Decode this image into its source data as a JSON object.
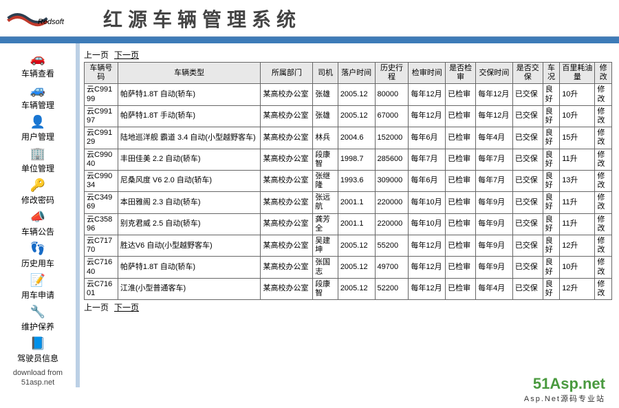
{
  "header": {
    "logo_text": "Redsoft",
    "title": "红源车辆管理系统"
  },
  "sidebar": {
    "items": [
      {
        "label": "车辆查看",
        "icon": "🚗"
      },
      {
        "label": "车辆管理",
        "icon": "🚙"
      },
      {
        "label": "用户管理",
        "icon": "👤"
      },
      {
        "label": "单位管理",
        "icon": "🏢"
      },
      {
        "label": "修改密码",
        "icon": "🔑"
      },
      {
        "label": "车辆公告",
        "icon": "📣"
      },
      {
        "label": "历史用车",
        "icon": "👣"
      },
      {
        "label": "用车申请",
        "icon": "📝"
      },
      {
        "label": "维护保养",
        "icon": "🔧"
      },
      {
        "label": "驾驶员信息",
        "icon": "📘"
      }
    ],
    "download_line1": "download from",
    "download_line2": "51asp.net"
  },
  "pager": {
    "prev": "上一页",
    "next": "下一页"
  },
  "table": {
    "headers": [
      "车辆号码",
      "车辆类型",
      "所属部门",
      "司机",
      "落户时间",
      "历史行程",
      "检审时间",
      "是否检审",
      "交保时间",
      "是否交保",
      "车况",
      "百里耗油量",
      "修改"
    ],
    "rows": [
      {
        "id": "云C99199",
        "type": "帕萨特1.8T 自动(轿车)",
        "dept": "某高校办公室",
        "driver": "张雄",
        "date": "2005.12",
        "mileage": "80000",
        "insp": "每年12月",
        "insp_ok": "已检审",
        "ins": "每年12月",
        "ins_ok": "已交保",
        "cond": "良好",
        "fuel": "10升",
        "edit": "修改"
      },
      {
        "id": "云C99197",
        "type": "帕萨特1.8T 手动(轿车)",
        "dept": "某高校办公室",
        "driver": "张雄",
        "date": "2005.12",
        "mileage": "67000",
        "insp": "每年12月",
        "insp_ok": "已检审",
        "ins": "每年12月",
        "ins_ok": "已交保",
        "cond": "良好",
        "fuel": "10升",
        "edit": "修改"
      },
      {
        "id": "云C99129",
        "type": "陆地巡洋舰 霸道 3.4 自动(小型越野客车)",
        "dept": "某高校办公室",
        "driver": "林兵",
        "date": "2004.6",
        "mileage": "152000",
        "insp": "每年6月",
        "insp_ok": "已检审",
        "ins": "每年4月",
        "ins_ok": "已交保",
        "cond": "良好",
        "fuel": "15升",
        "edit": "修改"
      },
      {
        "id": "云C99040",
        "type": "丰田佳美 2.2 自动(轿车)",
        "dept": "某高校办公室",
        "driver": "段康智",
        "date": "1998.7",
        "mileage": "285600",
        "insp": "每年7月",
        "insp_ok": "已检审",
        "ins": "每年7月",
        "ins_ok": "已交保",
        "cond": "良好",
        "fuel": "11升",
        "edit": "修改"
      },
      {
        "id": "云C99034",
        "type": "尼桑风度 V6 2.0 自动(轿车)",
        "dept": "某高校办公室",
        "driver": "张继隆",
        "date": "1993.6",
        "mileage": "309000",
        "insp": "每年6月",
        "insp_ok": "已检审",
        "ins": "每年7月",
        "ins_ok": "已交保",
        "cond": "良好",
        "fuel": "13升",
        "edit": "修改"
      },
      {
        "id": "云C34969",
        "type": "本田雅阁 2.3 自动(轿车)",
        "dept": "某高校办公室",
        "driver": "张远航",
        "date": "2001.1",
        "mileage": "220000",
        "insp": "每年10月",
        "insp_ok": "已检审",
        "ins": "每年9月",
        "ins_ok": "已交保",
        "cond": "良好",
        "fuel": "11升",
        "edit": "修改"
      },
      {
        "id": "云C35896",
        "type": "别克君威 2.5 自动(轿车)",
        "dept": "某高校办公室",
        "driver": "龚芳全",
        "date": "2001.1",
        "mileage": "220000",
        "insp": "每年10月",
        "insp_ok": "已检审",
        "ins": "每年9月",
        "ins_ok": "已交保",
        "cond": "良好",
        "fuel": "11升",
        "edit": "修改"
      },
      {
        "id": "云C71770",
        "type": "胜达V6 自动(小型越野客车)",
        "dept": "某高校办公室",
        "driver": "吴建坤",
        "date": "2005.12",
        "mileage": "55200",
        "insp": "每年12月",
        "insp_ok": "已检审",
        "ins": "每年9月",
        "ins_ok": "已交保",
        "cond": "良好",
        "fuel": "12升",
        "edit": "修改"
      },
      {
        "id": "云C71640",
        "type": "帕萨特1.8T 自动(轿车)",
        "dept": "某高校办公室",
        "driver": "张国志",
        "date": "2005.12",
        "mileage": "49700",
        "insp": "每年12月",
        "insp_ok": "已检审",
        "ins": "每年9月",
        "ins_ok": "已交保",
        "cond": "良好",
        "fuel": "10升",
        "edit": "修改"
      },
      {
        "id": "云C71601",
        "type": "江淮(小型普通客车)",
        "dept": "某高校办公室",
        "driver": "段康智",
        "date": "2005.12",
        "mileage": "52200",
        "insp": "每年12月",
        "insp_ok": "已检审",
        "ins": "每年4月",
        "ins_ok": "已交保",
        "cond": "良好",
        "fuel": "12升",
        "edit": "修改"
      }
    ]
  },
  "footer": {
    "brand": "51Asp.net",
    "sub": "Asp.Net源码专业站"
  }
}
